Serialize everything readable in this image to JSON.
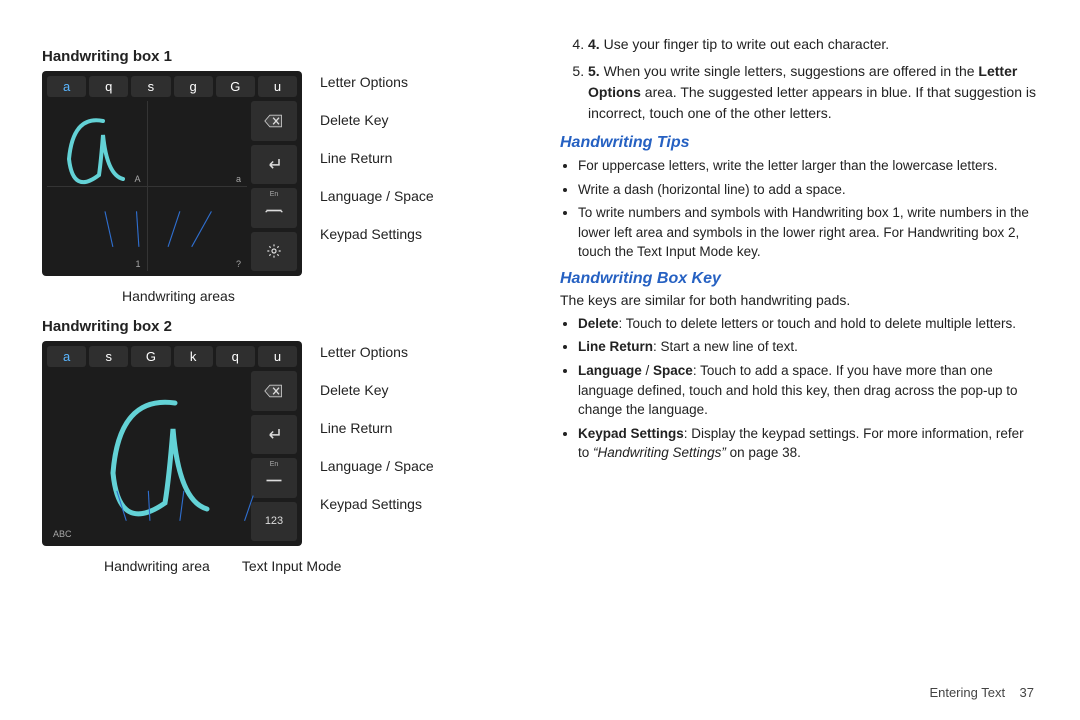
{
  "left": {
    "box1_title": "Handwriting box 1",
    "box2_title": "Handwriting box 2",
    "options1": [
      "a",
      "q",
      "s",
      "g",
      "G",
      "u"
    ],
    "options2": [
      "a",
      "s",
      "G",
      "k",
      "q",
      "u"
    ],
    "callouts": {
      "letter_options": "Letter Options",
      "delete_key": "Delete Key",
      "line_return": "Line Return",
      "language_space": "Language / Space",
      "keypad_settings": "Keypad Settings"
    },
    "cell_labels": {
      "tl": "A",
      "tr": "a",
      "bl": "1",
      "br": "?"
    },
    "num_key": "123",
    "abc_label": "ABC",
    "lang_small": "En",
    "under1": "Handwriting areas",
    "under2a": "Handwriting area",
    "under2b": "Text Input Mode"
  },
  "right": {
    "step4_num": "4.",
    "step4": "Use your finger tip to write out each character.",
    "step5_num": "5.",
    "step5_a": "When you write single letters, suggestions are offered in the ",
    "step5_bold": "Letter Options",
    "step5_b": " area. The suggested letter appears in blue. If that suggestion is incorrect, touch one of the other letters.",
    "tips_head": "Handwriting Tips",
    "tips": [
      "For uppercase letters, write the letter larger than the lowercase letters.",
      "Write a dash (horizontal line) to add a space.",
      "To write numbers and symbols with Handwriting box 1, write numbers in the lower left area and symbols in the lower right area. For Handwriting box 2, touch the Text Input Mode key."
    ],
    "boxkey_head": "Handwriting Box Key",
    "boxkey_intro": "The keys are similar for both handwriting pads.",
    "delete_bold": "Delete",
    "delete_text": ": Touch to delete letters or touch and hold to delete multiple letters.",
    "lr_bold": "Line Return",
    "lr_text": ": Start a new line of text.",
    "lang_bold1": "Language",
    "lang_bold2": "Space",
    "lang_text": ": Touch to add a space. If you have more than one language defined, touch and hold this key, then drag across the pop-up to change the language.",
    "kp_bold": "Keypad Settings",
    "kp_text_a": ": Display the keypad settings. For more information, refer to ",
    "kp_ital": "“Handwriting Settings”",
    "kp_text_b": " on page 38."
  },
  "footer": {
    "section": "Entering Text",
    "page": "37"
  }
}
